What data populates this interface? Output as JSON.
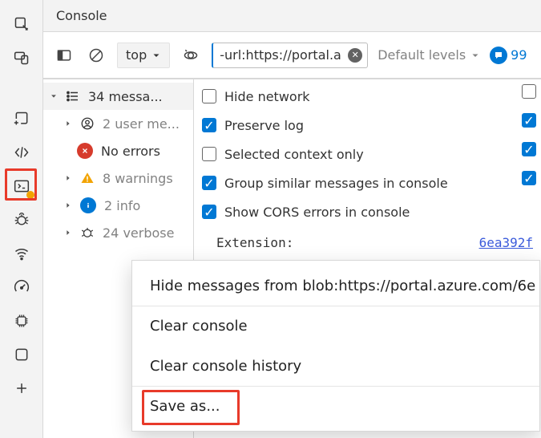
{
  "title": "Console",
  "toolbar": {
    "context": "top",
    "filter_value": "-url:https://portal.a",
    "levels_label": "Default levels",
    "issue_count": "99"
  },
  "groups": {
    "header": "34 messa...",
    "items": [
      {
        "label": "2 user me...",
        "kind": "user"
      },
      {
        "label": "No errors",
        "kind": "error"
      },
      {
        "label": "8 warnings",
        "kind": "warn",
        "count": "8"
      },
      {
        "label": "2 info",
        "kind": "info",
        "count": "2"
      },
      {
        "label": "24 verbose",
        "kind": "verbose",
        "count": "24"
      }
    ]
  },
  "settings": {
    "hide_network": "Hide network",
    "preserve_log": "Preserve log",
    "selected_context": "Selected context only",
    "group_similar": "Group similar messages in console",
    "show_cors": "Show CORS errors in console"
  },
  "extension": {
    "label": "Extension:",
    "link": "6ea392f"
  },
  "context_menu": {
    "hide_messages": "Hide messages from blob:https://portal.azure.com/6e",
    "clear_console": "Clear console",
    "clear_history": "Clear console history",
    "save_as": "Save as..."
  },
  "icons": {
    "checkmark": "✓"
  }
}
